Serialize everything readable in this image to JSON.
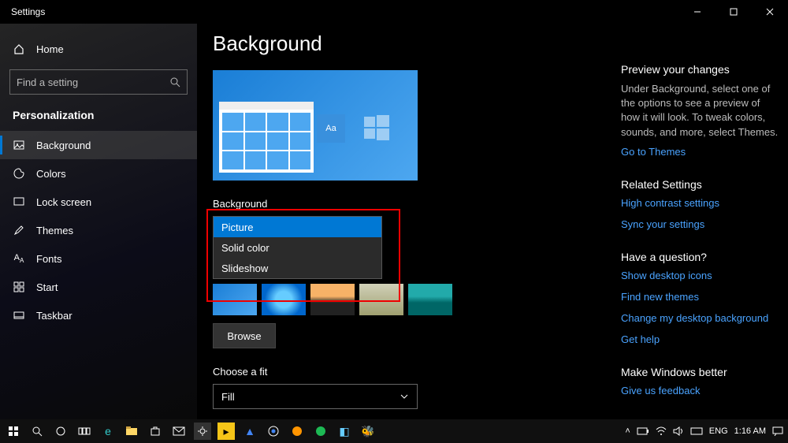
{
  "titlebar": {
    "title": "Settings"
  },
  "sidebar": {
    "home": "Home",
    "search_placeholder": "Find a setting",
    "section": "Personalization",
    "items": [
      {
        "label": "Background",
        "active": true
      },
      {
        "label": "Colors"
      },
      {
        "label": "Lock screen"
      },
      {
        "label": "Themes"
      },
      {
        "label": "Fonts"
      },
      {
        "label": "Start"
      },
      {
        "label": "Taskbar"
      }
    ]
  },
  "main": {
    "heading": "Background",
    "preview_tile_text": "Aa",
    "bg_label": "Background",
    "bg_options": [
      "Picture",
      "Solid color",
      "Slideshow"
    ],
    "bg_selected": "Picture",
    "browse_label": "Browse",
    "fit_label": "Choose a fit",
    "fit_value": "Fill"
  },
  "right": {
    "preview_head": "Preview your changes",
    "preview_body": "Under Background, select one of the options to see a preview of how it will look. To tweak colors, sounds, and more, select Themes.",
    "themes_link": "Go to Themes",
    "related_head": "Related Settings",
    "related_links": [
      "High contrast settings",
      "Sync your settings"
    ],
    "question_head": "Have a question?",
    "question_links": [
      "Show desktop icons",
      "Find new themes",
      "Change my desktop background",
      "Get help"
    ],
    "better_head": "Make Windows better",
    "better_link": "Give us feedback"
  },
  "tray": {
    "lang": "ENG",
    "time": "1:16 AM"
  }
}
